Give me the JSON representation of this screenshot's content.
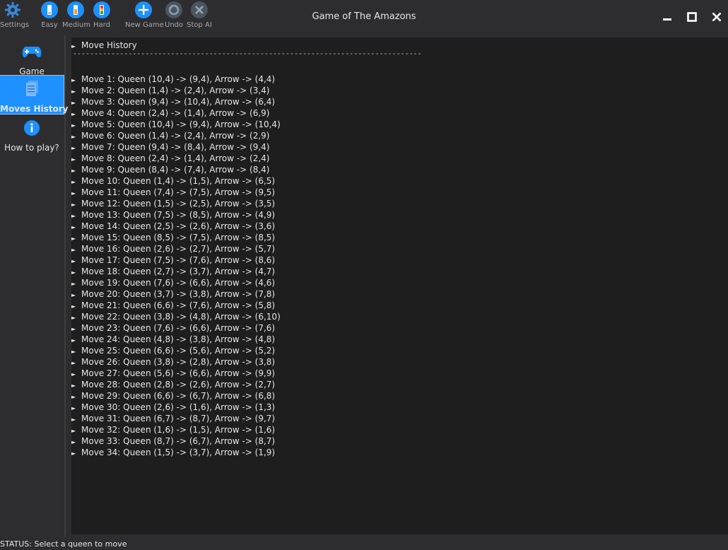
{
  "window": {
    "title": "Game of The Amazons"
  },
  "toolbar": {
    "settings_label": "Settings",
    "easy_label": "Easy",
    "medium_label": "Medium",
    "hard_label": "Hard",
    "new_game_label": "New Game",
    "undo_label": "Undo",
    "stop_ai_label": "Stop AI"
  },
  "sidebar": {
    "items": [
      {
        "label": "Game",
        "icon": "gamepad-icon"
      },
      {
        "label": "Moves History",
        "icon": "document-stack-icon"
      },
      {
        "label": "How to play?",
        "icon": "info-icon"
      }
    ]
  },
  "history": {
    "header": "Move History",
    "divider": "----------------------------------------------------------------------------------",
    "moves": [
      "Move 1: Queen (10,4) -> (9,4), Arrow -> (4,4)",
      "Move 2: Queen (1,4) -> (2,4), Arrow -> (3,4)",
      "Move 3: Queen (9,4) -> (10,4), Arrow -> (6,4)",
      "Move 4: Queen (2,4) -> (1,4), Arrow -> (6,9)",
      "Move 5: Queen (10,4) -> (9,4), Arrow -> (10,4)",
      "Move 6: Queen (1,4) -> (2,4), Arrow -> (2,9)",
      "Move 7: Queen (9,4) -> (8,4), Arrow -> (9,4)",
      "Move 8: Queen (2,4) -> (1,4), Arrow -> (2,4)",
      "Move 9: Queen (8,4) -> (7,4), Arrow -> (8,4)",
      "Move 10: Queen (1,4) -> (1,5), Arrow -> (6,5)",
      "Move 11: Queen (7,4) -> (7,5), Arrow -> (9,5)",
      "Move 12: Queen (1,5) -> (2,5), Arrow -> (3,5)",
      "Move 13: Queen (7,5) -> (8,5), Arrow -> (4,9)",
      "Move 14: Queen (2,5) -> (2,6), Arrow -> (3,6)",
      "Move 15: Queen (8,5) -> (7,5), Arrow -> (8,5)",
      "Move 16: Queen (2,6) -> (2,7), Arrow -> (5,7)",
      "Move 17: Queen (7,5) -> (7,6), Arrow -> (8,6)",
      "Move 18: Queen (2,7) -> (3,7), Arrow -> (4,7)",
      "Move 19: Queen (7,6) -> (6,6), Arrow -> (4,6)",
      "Move 20: Queen (3,7) -> (3,8), Arrow -> (7,8)",
      "Move 21: Queen (6,6) -> (7,6), Arrow -> (5,8)",
      "Move 22: Queen (3,8) -> (4,8), Arrow -> (6,10)",
      "Move 23: Queen (7,6) -> (6,6), Arrow -> (7,6)",
      "Move 24: Queen (4,8) -> (3,8), Arrow -> (4,8)",
      "Move 25: Queen (6,6) -> (5,6), Arrow -> (5,2)",
      "Move 26: Queen (3,8) -> (2,8), Arrow -> (3,8)",
      "Move 27: Queen (5,6) -> (6,6), Arrow -> (9,9)",
      "Move 28: Queen (2,8) -> (2,6), Arrow -> (2,7)",
      "Move 29: Queen (6,6) -> (6,7), Arrow -> (6,8)",
      "Move 30: Queen (2,6) -> (1,6), Arrow -> (1,3)",
      "Move 31: Queen (6,7) -> (8,7), Arrow -> (9,7)",
      "Move 32: Queen (1,6) -> (1,5), Arrow -> (1,6)",
      "Move 33: Queen (8,7) -> (6,7), Arrow -> (8,7)",
      "Move 34: Queen (1,5) -> (3,7), Arrow -> (1,9)"
    ]
  },
  "status": {
    "text": "STATUS: Select a queen to move"
  },
  "colors": {
    "accent": "#1e90ff",
    "background": "#2d2d30",
    "panel": "#1e1e1e"
  }
}
